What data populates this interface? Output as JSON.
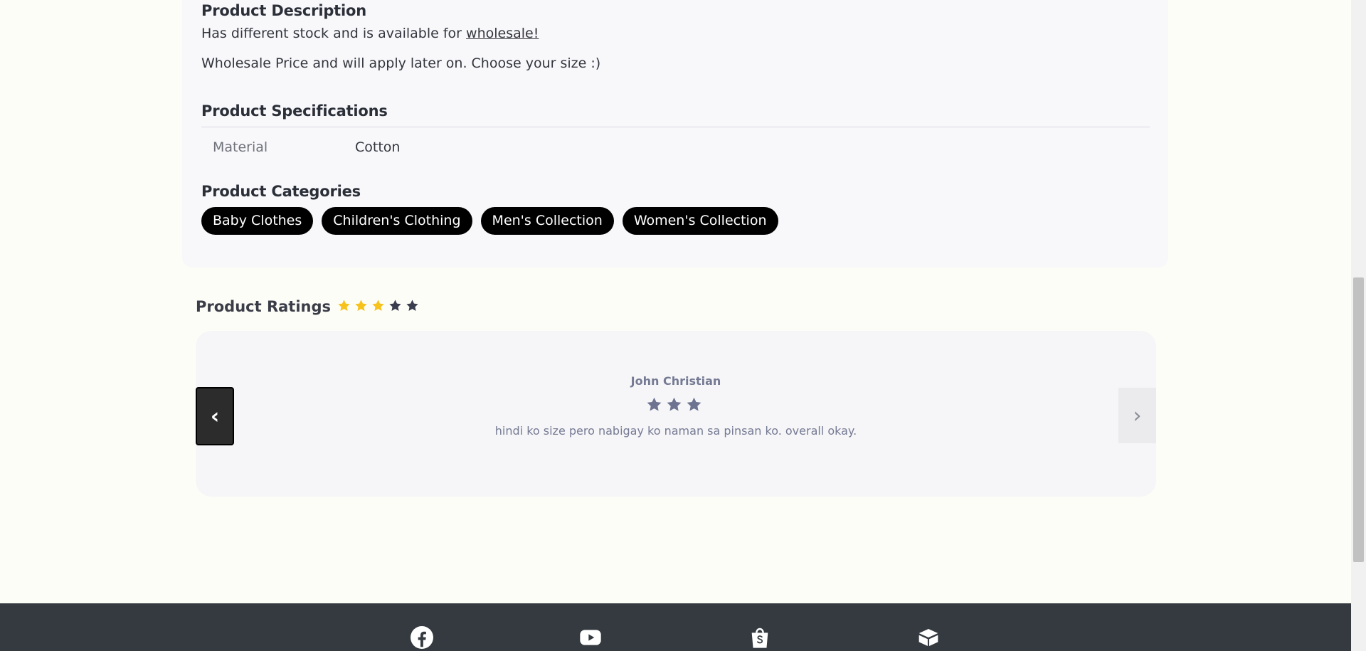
{
  "description": {
    "title": "Product Description",
    "line1_prefix": "Has different stock and is available for ",
    "line1_link": "wholesale!",
    "line2": "Wholesale Price and will apply later on. Choose your size :)"
  },
  "specifications": {
    "title": "Product Specifications",
    "rows": [
      {
        "key": "Material",
        "value": "Cotton"
      }
    ]
  },
  "categories": {
    "title": "Product Categories",
    "items": [
      "Baby Clothes",
      "Children's Clothing",
      "Men's Collection",
      "Women's Collection"
    ]
  },
  "ratings": {
    "title": "Product Ratings",
    "score": 3,
    "max": 5,
    "star_filled_color": "#f7c21b",
    "star_empty_color": "#3a3d4d"
  },
  "review": {
    "reviewer": "John Christian",
    "stars": 3,
    "star_color": "#6d7391",
    "text": "hindi ko size pero nabigay ko naman sa pinsan ko. overall okay.",
    "prev_label": "‹",
    "next_label": "›"
  },
  "footer": {
    "icons": [
      "facebook-icon",
      "youtube-icon",
      "shopee-icon",
      "box-icon"
    ]
  }
}
